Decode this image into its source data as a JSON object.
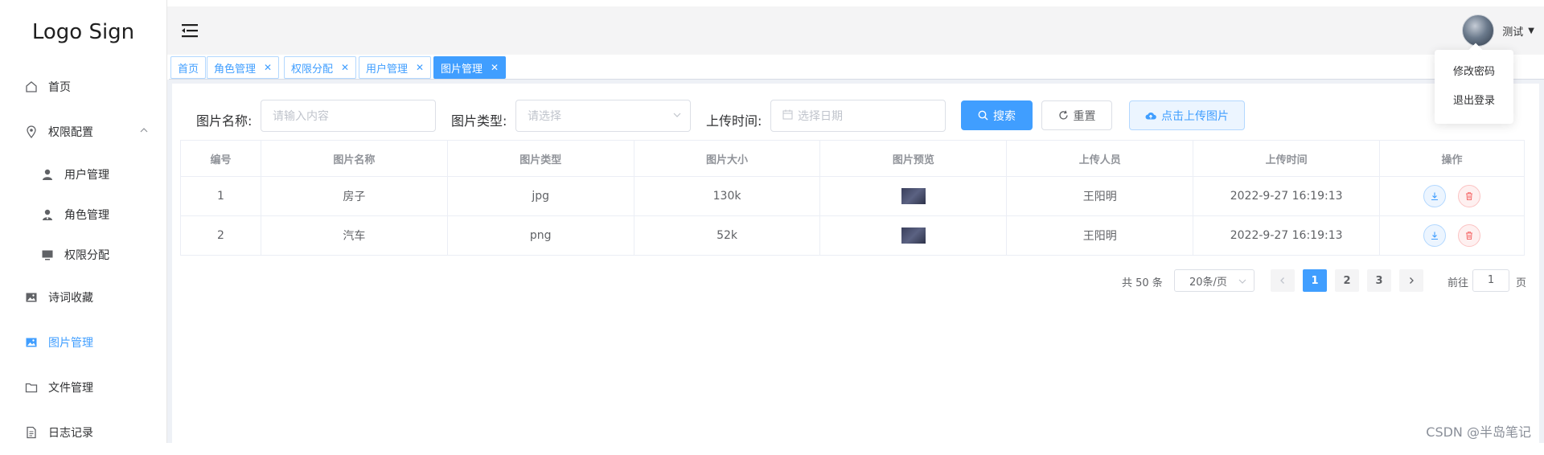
{
  "sidebar": {
    "logo": "Logo Sign",
    "items": [
      {
        "label": "首页"
      },
      {
        "label": "权限配置"
      },
      {
        "label": "用户管理"
      },
      {
        "label": "角色管理"
      },
      {
        "label": "权限分配"
      },
      {
        "label": "诗词收藏"
      },
      {
        "label": "图片管理"
      },
      {
        "label": "文件管理"
      },
      {
        "label": "日志记录"
      }
    ],
    "active_color": "#409eff"
  },
  "header": {
    "username": "测试",
    "dropdown": [
      "修改密码",
      "退出登录"
    ]
  },
  "tags": [
    {
      "label": "首页"
    },
    {
      "label": "角色管理"
    },
    {
      "label": "权限分配"
    },
    {
      "label": "用户管理"
    },
    {
      "label": "图片管理"
    }
  ],
  "filters": {
    "name_label": "图片名称:",
    "name_placeholder": "请输入内容",
    "type_label": "图片类型:",
    "type_placeholder": "请选择",
    "time_label": "上传时间:",
    "time_placeholder": "选择日期",
    "search_btn": "搜索",
    "reset_btn": "重置",
    "upload_btn": "点击上传图片"
  },
  "table": {
    "headers": [
      "编号",
      "图片名称",
      "图片类型",
      "图片大小",
      "图片预览",
      "上传人员",
      "上传时间",
      "操作"
    ],
    "rows": [
      {
        "id": "1",
        "name": "房子",
        "type": "jpg",
        "size": "130k",
        "uploader": "王阳明",
        "time": "2022-9-27 16:19:13"
      },
      {
        "id": "2",
        "name": "汽车",
        "type": "png",
        "size": "52k",
        "uploader": "王阳明",
        "time": "2022-9-27 16:19:13"
      }
    ]
  },
  "pagination": {
    "total": "共 50 条",
    "page_size": "20条/页",
    "pages": [
      "1",
      "2",
      "3"
    ],
    "goto_label": "前往",
    "goto_value": "1",
    "page_suffix": "页"
  },
  "watermark": "CSDN @半岛笔记"
}
